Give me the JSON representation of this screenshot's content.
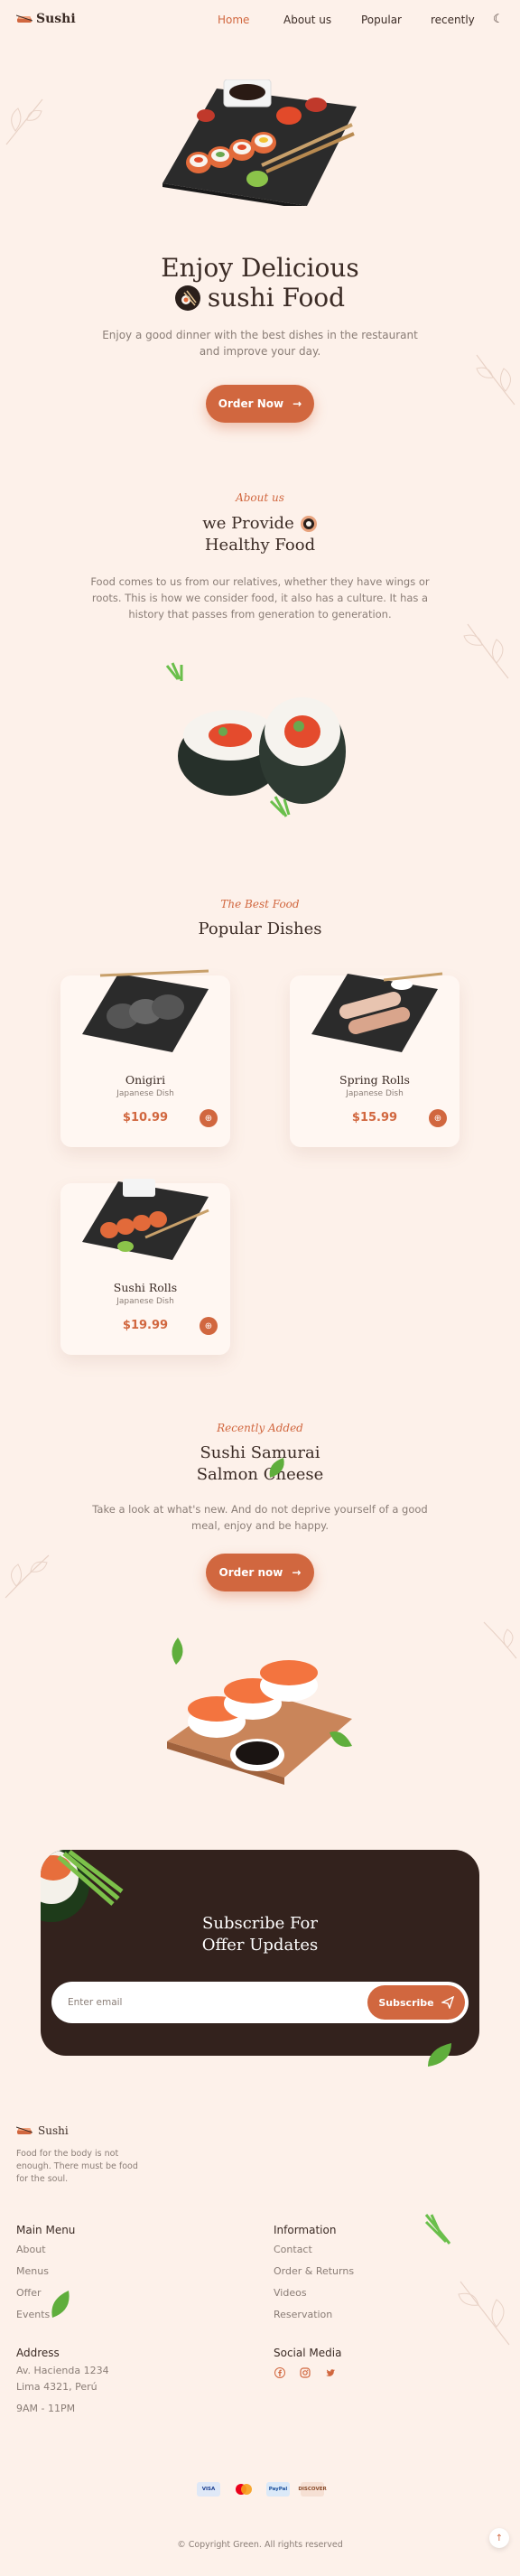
{
  "header": {
    "logo": "Sushi",
    "nav": [
      {
        "label": "Home",
        "active": true
      },
      {
        "label": "About us"
      },
      {
        "label": "Popular"
      },
      {
        "label": "recently"
      }
    ],
    "theme_icon": "moon-icon"
  },
  "hero": {
    "title_line1": "Enjoy Delicious",
    "title_line2": "sushi Food",
    "description": "Enjoy a good dinner with the best dishes in the restaurant and improve your day.",
    "cta": "Order Now"
  },
  "about": {
    "subtitle": "About us",
    "title_line1": "we Provide",
    "title_line2": "Healthy Food",
    "description": "Food comes to us from our relatives, whether they have wings or roots. This is how we consider food, it also has a culture. It has a history that passes from generation to generation."
  },
  "popular": {
    "subtitle": "The Best Food",
    "title": "Popular Dishes",
    "dishes": [
      {
        "name": "Onigiri",
        "category": "Japanese Dish",
        "price": "$10.99"
      },
      {
        "name": "Spring Rolls",
        "category": "Japanese Dish",
        "price": "$15.99"
      },
      {
        "name": "Sushi Rolls",
        "category": "Japanese Dish",
        "price": "$19.99"
      }
    ]
  },
  "recently": {
    "subtitle": "Recently Added",
    "title_line1": "Sushi Samurai",
    "title_line2": "Salmon Cheese",
    "description": "Take a look at what's new. And do not deprive yourself of a good meal, enjoy and be happy.",
    "cta": "Order now"
  },
  "subscribe": {
    "title_line1": "Subscribe For",
    "title_line2": "Offer Updates",
    "placeholder": "Enter email",
    "button": "Subscribe"
  },
  "footer": {
    "logo": "Sushi",
    "description": "Food for the body is not enough. There must be food for the soul.",
    "main_menu": {
      "title": "Main Menu",
      "links": [
        "About",
        "Menus",
        "Offer",
        "Events"
      ]
    },
    "information": {
      "title": "Information",
      "links": [
        "Contact",
        "Order & Returns",
        "Videos",
        "Reservation"
      ]
    },
    "address": {
      "title": "Address",
      "lines": [
        "Av. Hacienda 1234",
        "Lima 4321, Perú"
      ],
      "hours": "9AM - 11PM"
    },
    "social": {
      "title": "Social Media",
      "icons": [
        "facebook-icon",
        "instagram-icon",
        "twitter-icon"
      ]
    },
    "payments": [
      "VISA",
      "mastercard",
      "PayPal",
      "DISCOVER"
    ],
    "copyright": "© Copyright Green. All rights reserved"
  },
  "colors": {
    "accent": "#d1673f",
    "background": "#fdf1ea",
    "dark": "#33221d"
  }
}
